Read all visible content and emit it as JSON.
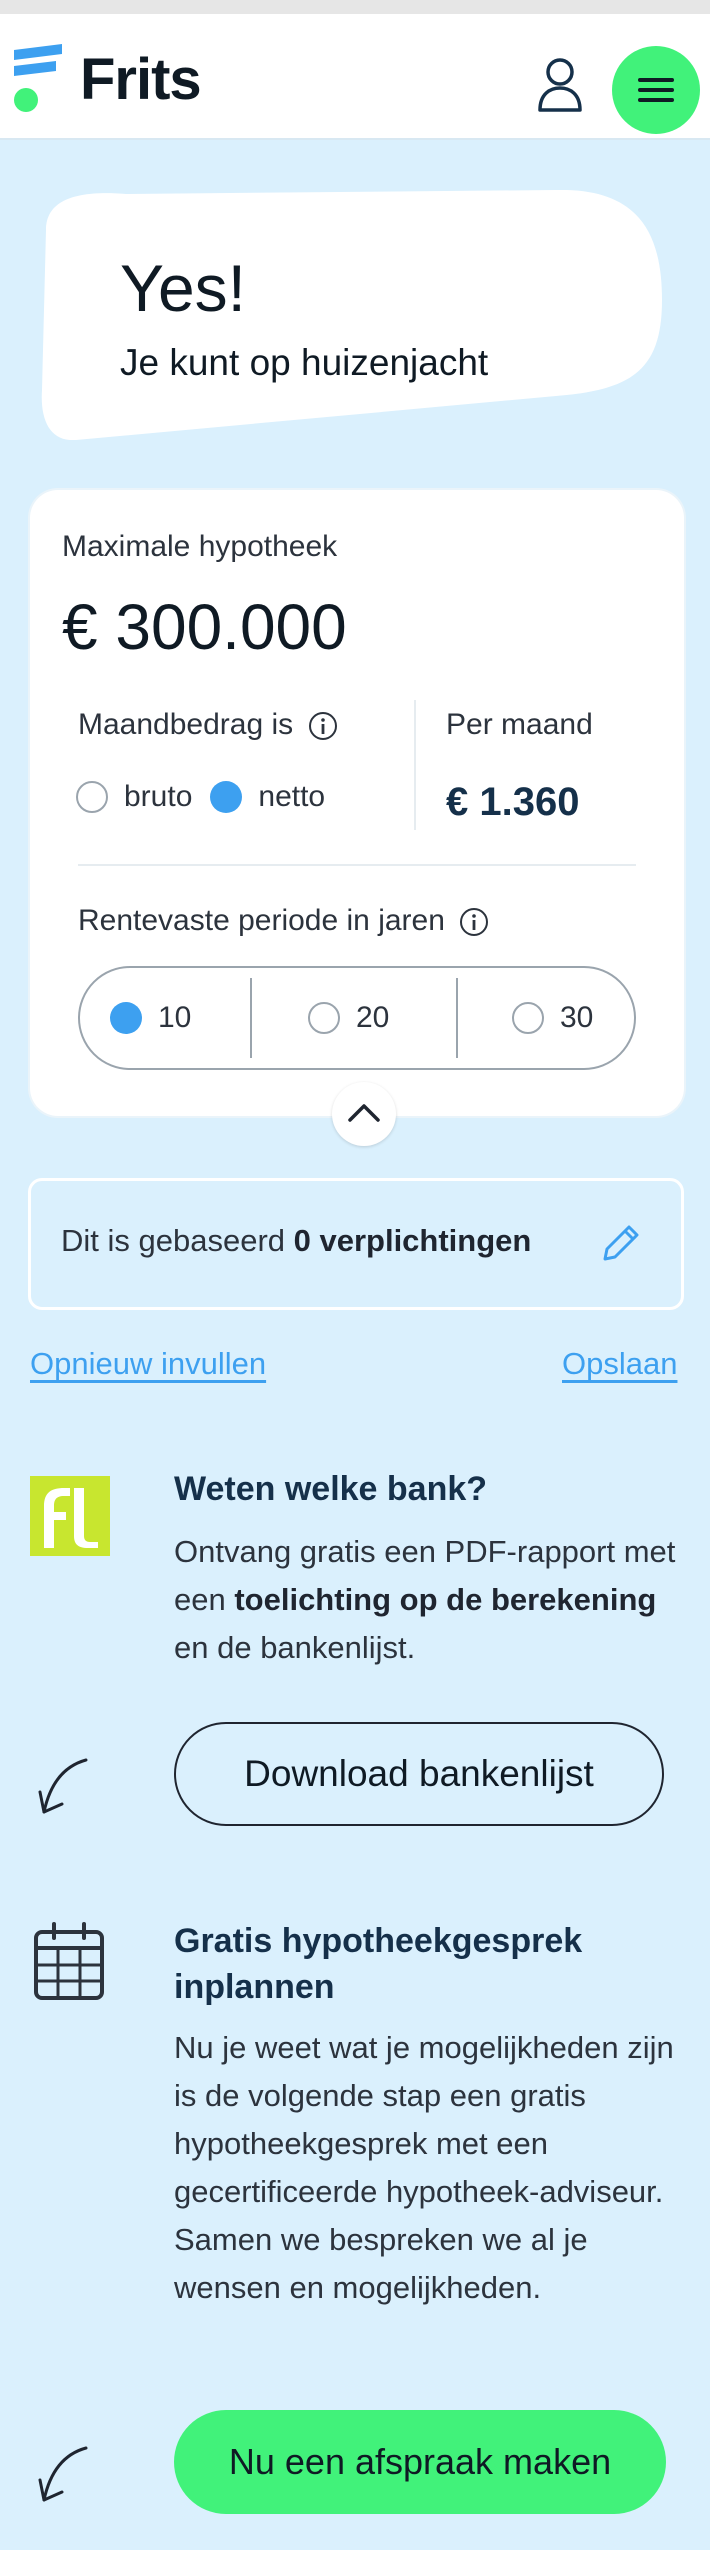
{
  "header": {
    "brand": "Frits",
    "user_icon": "user-icon",
    "menu_icon": "hamburger-menu-icon",
    "accent_color": "#41f27a"
  },
  "hero": {
    "title": "Yes!",
    "subtitle": "Je kunt op huizenjacht"
  },
  "result_card": {
    "max_label": "Maximale hypotheek",
    "max_value": "€ 300.000",
    "monthly_label": "Maandbedrag is",
    "monthly_options": [
      "bruto",
      "netto"
    ],
    "monthly_selected": "netto",
    "per_month_label": "Per maand",
    "per_month_value": "€ 1.360",
    "fixed_period_label": "Rentevaste periode in jaren",
    "fixed_period_options": [
      "10",
      "20",
      "30"
    ],
    "fixed_period_selected": "10",
    "collapse_icon": "chevron-up-icon"
  },
  "obligations": {
    "prefix": "Dit is gebaseerd ",
    "bold": "0 verplichtingen",
    "edit_icon": "pencil-icon"
  },
  "links": {
    "refill": "Opnieuw invullen",
    "save": "Opslaan"
  },
  "bank_section": {
    "title": "Weten welke bank?",
    "body_1": "Ontvang gratis een PDF-rapport met een ",
    "body_bold": "toelichting op de berekening",
    "body_2": " en de bankenlijst.",
    "button": "Download bankenlijst"
  },
  "appointment_section": {
    "title": "Gratis hypotheekgesprek inplannen",
    "body": "Nu je weet wat je mogelijkheden zijn is de volgende stap een gratis hypotheekgesprek met een gecertificeerde hypotheek-adviseur. Samen we bespreken we al je wensen en mogelijkheden.",
    "button": "Nu een afspraak maken"
  }
}
